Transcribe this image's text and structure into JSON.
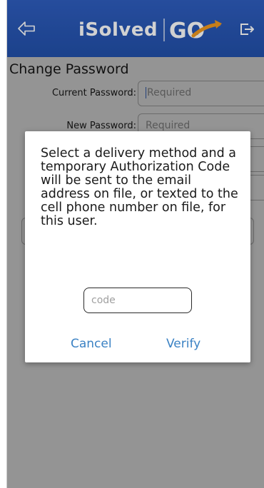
{
  "header": {
    "brand_text": "iSolved",
    "brand_logo_text": "GO",
    "back_icon": "back-arrow-icon",
    "logout_icon": "logout-icon",
    "color": "#2756b3"
  },
  "page": {
    "title": "Change Password",
    "fields": [
      {
        "label": "Current Password:",
        "placeholder": "Required"
      },
      {
        "label": "New Password:",
        "placeholder": "Required"
      }
    ]
  },
  "dialog": {
    "message": "Select a delivery method and a temporary Authorization Code will be sent to the email address on file, or texted to the cell phone number on file, for this user.",
    "code_placeholder": "code",
    "cancel_label": "Cancel",
    "verify_label": "Verify",
    "accent": "#3b82c4"
  }
}
